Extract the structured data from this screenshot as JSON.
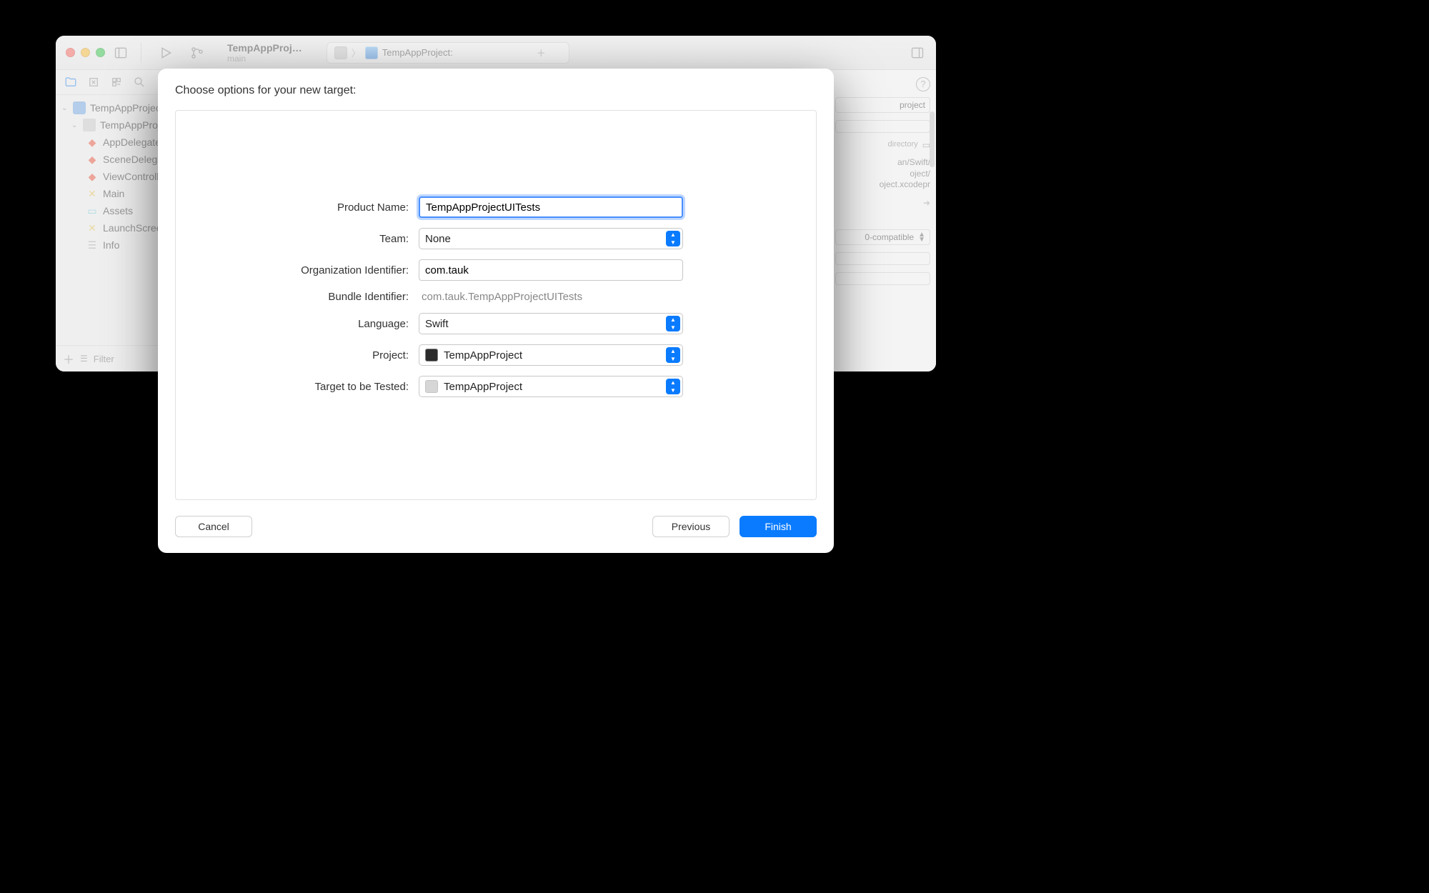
{
  "window": {
    "scheme_title": "TempAppProj…",
    "scheme_branch": "main",
    "breadcrumb_tab": "TempAppProject:"
  },
  "navigator": {
    "project": "TempAppProject",
    "folder": "TempAppProject",
    "files": {
      "appdelegate": "AppDelegate",
      "scenedelegate": "SceneDelegate",
      "viewcontroller": "ViewController",
      "main": "Main",
      "assets": "Assets",
      "launchscreen": "LaunchScreen",
      "info": "Info"
    },
    "filter_placeholder": "Filter"
  },
  "inspector": {
    "name_value": "project",
    "location_label": "directory",
    "path_line1": "an/Swift/",
    "path_line2": "oject/",
    "path_line3": "oject.xcodepr",
    "format_value": "0-compatible"
  },
  "sheet": {
    "title": "Choose options for your new target:",
    "labels": {
      "product_name": "Product Name:",
      "team": "Team:",
      "org_id": "Organization Identifier:",
      "bundle_id": "Bundle Identifier:",
      "language": "Language:",
      "project": "Project:",
      "target": "Target to be Tested:"
    },
    "values": {
      "product_name": "TempAppProjectUITests",
      "team": "None",
      "org_id": "com.tauk",
      "bundle_id": "com.tauk.TempAppProjectUITests",
      "language": "Swift",
      "project": "TempAppProject",
      "target": "TempAppProject"
    },
    "buttons": {
      "cancel": "Cancel",
      "previous": "Previous",
      "finish": "Finish"
    }
  }
}
